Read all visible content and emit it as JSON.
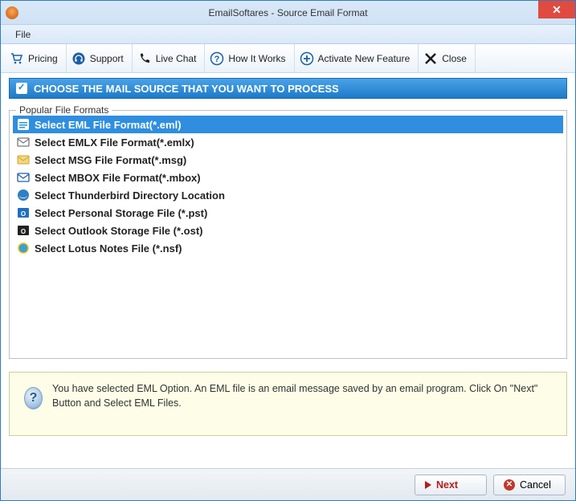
{
  "window": {
    "title": "EmailSoftares - Source Email Format"
  },
  "menubar": {
    "file": "File"
  },
  "toolbar": {
    "pricing": "Pricing",
    "support": "Support",
    "live_chat": "Live Chat",
    "how_it_works": "How It Works",
    "activate": "Activate New Feature",
    "close": "Close"
  },
  "section_header": "CHOOSE THE MAIL SOURCE THAT YOU WANT TO PROCESS",
  "groupbox_title": "Popular File Formats",
  "formats": [
    {
      "label": "Select EML File Format(*.eml)",
      "icon": "eml",
      "selected": true
    },
    {
      "label": "Select EMLX File Format(*.emlx)",
      "icon": "emlx",
      "selected": false
    },
    {
      "label": "Select MSG File Format(*.msg)",
      "icon": "msg",
      "selected": false
    },
    {
      "label": "Select MBOX File Format(*.mbox)",
      "icon": "mbox",
      "selected": false
    },
    {
      "label": "Select Thunderbird Directory Location",
      "icon": "thunderbird",
      "selected": false
    },
    {
      "label": "Select Personal Storage File (*.pst)",
      "icon": "pst",
      "selected": false
    },
    {
      "label": "Select Outlook Storage File (*.ost)",
      "icon": "ost",
      "selected": false
    },
    {
      "label": "Select Lotus Notes File (*.nsf)",
      "icon": "nsf",
      "selected": false
    }
  ],
  "info_text": "You have selected EML Option. An EML file is an email message saved by an email program. Click On \"Next\" Button and Select EML Files.",
  "footer": {
    "next": "Next",
    "cancel": "Cancel"
  }
}
